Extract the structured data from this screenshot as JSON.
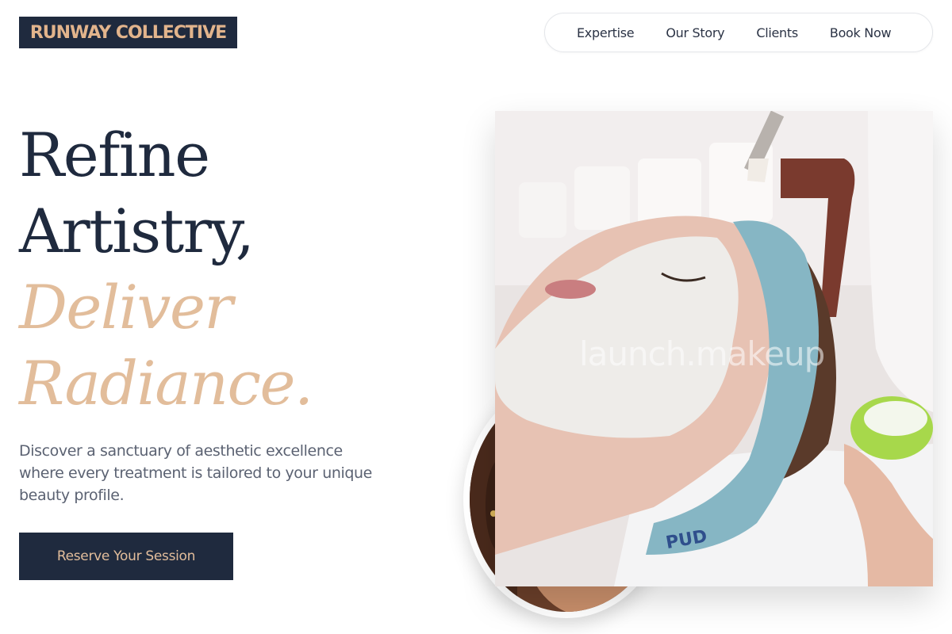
{
  "header": {
    "logo_text": "RUNWAY COLLECTIVE",
    "nav": [
      {
        "label": "Expertise"
      },
      {
        "label": "Our Story"
      },
      {
        "label": "Clients"
      },
      {
        "label": "Book Now"
      }
    ]
  },
  "hero": {
    "headline_lines": [
      "Refine",
      "Artistry,"
    ],
    "accent_lines": [
      "Deliver",
      "Radiance."
    ],
    "description": "Discover a sanctuary of aesthetic excellence where every treatment is tailored to your unique beauty profile.",
    "cta_label": "Reserve Your Session"
  },
  "images": {
    "main_photo": {
      "watermark": "launch.makeup"
    },
    "headband_text": "PUD"
  },
  "colors": {
    "navy": "#1f2a3e",
    "accent_tan": "#e2bd9b",
    "body_text": "#5b6272"
  }
}
